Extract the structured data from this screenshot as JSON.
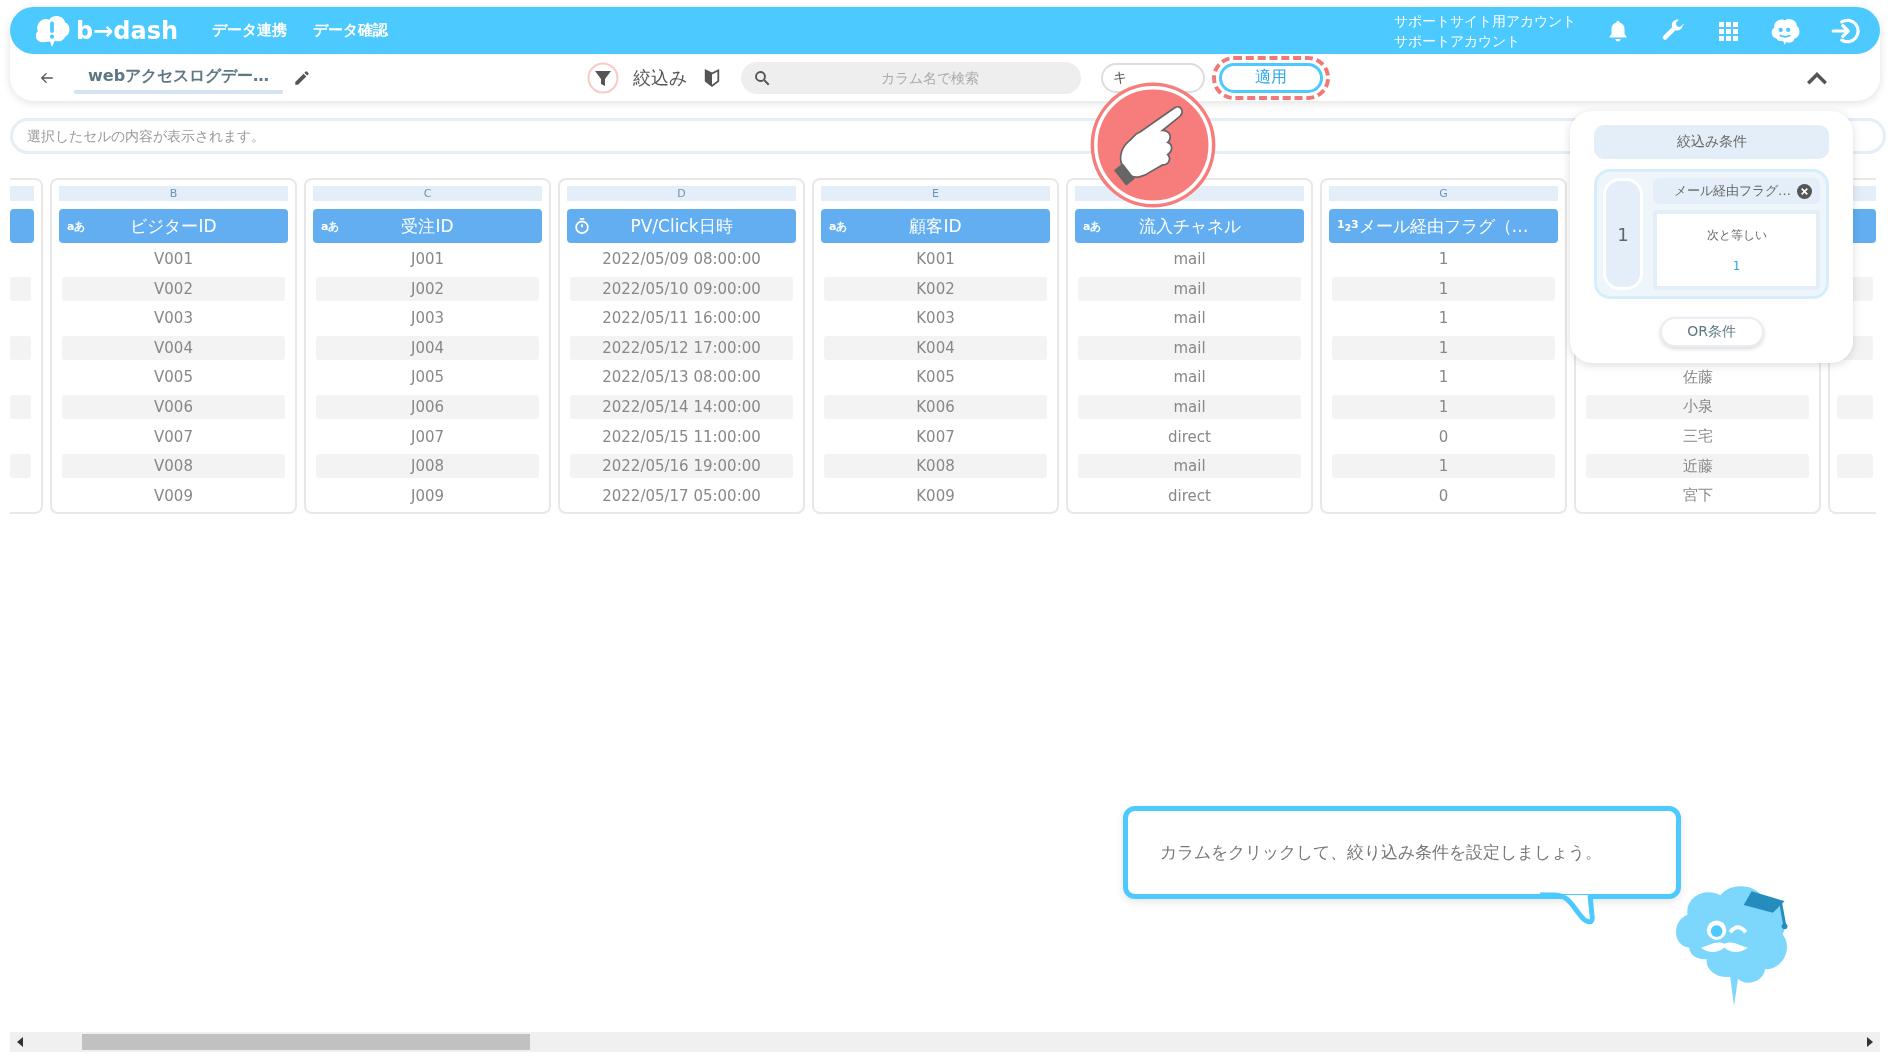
{
  "topbar": {
    "logo": "b→dash",
    "nav": [
      {
        "label": "データ連携"
      },
      {
        "label": "データ確認"
      }
    ],
    "account": [
      "サポートサイト用アカウント",
      "サポートアカウント"
    ]
  },
  "toolbar": {
    "title": "webアクセスログデー…",
    "filter_label": "絞込み",
    "search": {
      "placeholder": "カラム名で検索"
    },
    "cancel_label": "キ",
    "apply_label": "適用",
    "apply_highlighted": true
  },
  "cell_field": {
    "placeholder": "選択したセルの内容が表示されます。"
  },
  "columns": [
    {
      "letter": "B",
      "kind": "label",
      "type_label": "aあ",
      "title": "ビジターID",
      "cells": [
        "V001",
        "V002",
        "V003",
        "V004",
        "V005",
        "V006",
        "V007",
        "V008",
        "V009"
      ]
    },
    {
      "letter": "C",
      "kind": "label",
      "type_label": "aあ",
      "title": "受注ID",
      "cells": [
        "J001",
        "J002",
        "J003",
        "J004",
        "J005",
        "J006",
        "J007",
        "J008",
        "J009"
      ]
    },
    {
      "letter": "D",
      "kind": "stopwatch",
      "title": "PV/Click日時",
      "cells": [
        "2022/05/09 08:00:00",
        "2022/05/10 09:00:00",
        "2022/05/11 16:00:00",
        "2022/05/12 17:00:00",
        "2022/05/13 08:00:00",
        "2022/05/14 14:00:00",
        "2022/05/15 11:00:00",
        "2022/05/16 19:00:00",
        "2022/05/17 05:00:00"
      ]
    },
    {
      "letter": "E",
      "kind": "label",
      "type_label": "aあ",
      "title": "顧客ID",
      "cells": [
        "K001",
        "K002",
        "K003",
        "K004",
        "K005",
        "K006",
        "K007",
        "K008",
        "K009"
      ]
    },
    {
      "kind": "label",
      "type_label": "aあ",
      "title": "流入チャネル",
      "cells": [
        "mail",
        "mail",
        "mail",
        "mail",
        "mail",
        "mail",
        "direct",
        "mail",
        "direct"
      ]
    },
    {
      "letter": "G",
      "kind": "label",
      "type_label": "1$_{2}$3",
      "title": "メール経由フラグ（…",
      "cells": [
        "1",
        "1",
        "1",
        "1",
        "1",
        "1",
        "0",
        "1",
        "0"
      ]
    },
    {
      "cells": [
        null,
        null,
        null,
        null,
        "佐藤",
        "小泉",
        "三宅",
        "近藤",
        "宮下"
      ]
    }
  ],
  "filter_panel": {
    "title": "絞込み条件",
    "groups": [
      {
        "number": "1",
        "conditions": [
          {
            "column": "メール経由フラグ…",
            "operator": "次と等しい",
            "value": "1"
          }
        ]
      }
    ],
    "or_button": "OR条件"
  },
  "tutorial": {
    "message": "カラムをクリックして、絞り込み条件を設定しましょう。"
  }
}
